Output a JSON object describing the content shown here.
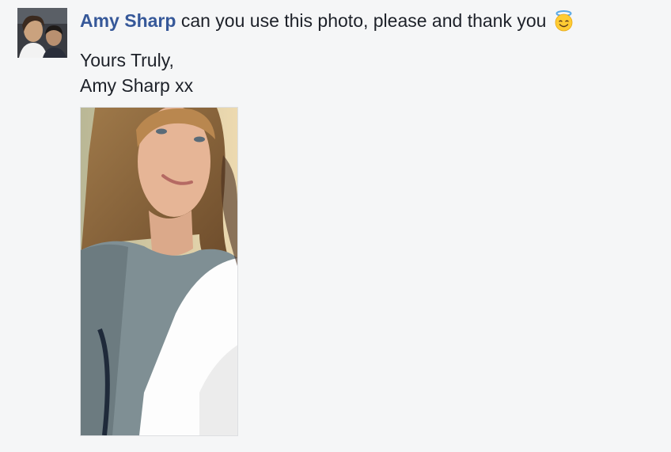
{
  "comment": {
    "author_name": "Amy Sharp",
    "message": " can you use this photo, please and thank you",
    "emoji_icon": "smiling-face-with-halo-icon",
    "signoff_line1": "Yours Truly,",
    "signoff_line2": "Amy Sharp xx"
  },
  "colors": {
    "author_link": "#365899",
    "text": "#1d2129",
    "background": "#f5f6f7"
  }
}
